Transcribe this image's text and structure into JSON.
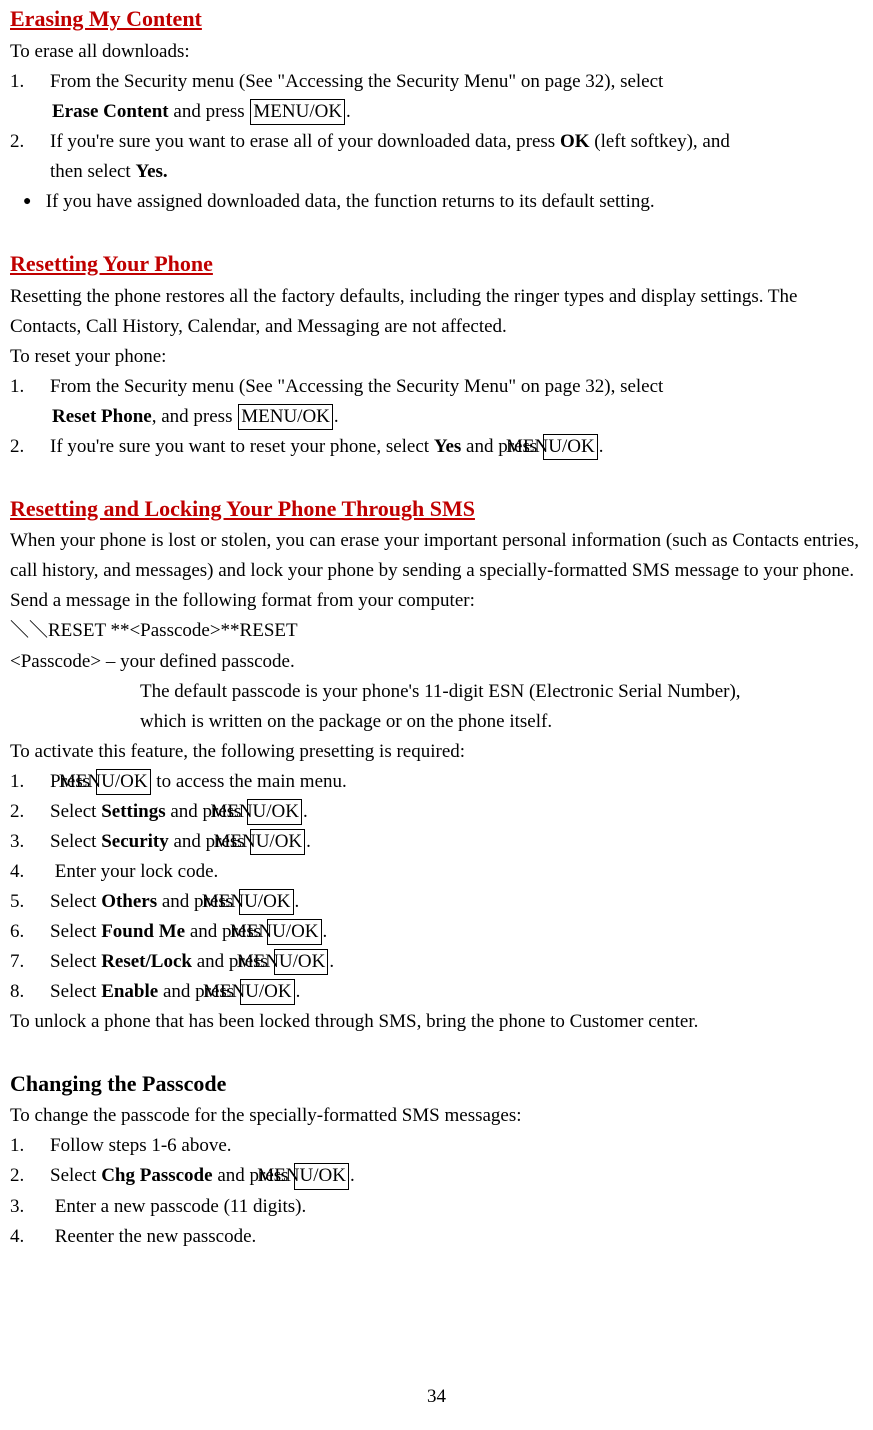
{
  "s1": {
    "heading": "Erasing My Content",
    "intro": "To erase all downloads:",
    "li1a": "From the Security menu (See \"Accessing the Security Menu\" on page 32), select",
    "li1b_bold": "Erase Content",
    "li1b_rest": " and press ",
    "li1b_box": "MENU/OK",
    "li1b_end": ".",
    "li2a": "If you're sure you want to erase all of your downloaded data, press ",
    "li2a_bold": "OK",
    "li2a_rest": " (left softkey), and",
    "li2b": "then select ",
    "li2b_bold": "Yes.",
    "bul": " If you have assigned downloaded data, the function returns to its default setting."
  },
  "s2": {
    "heading": "Resetting Your Phone",
    "p1": "Resetting the phone restores all the factory defaults, including the ringer types and display settings. The Contacts, Call History, Calendar, and Messaging are not affected.",
    "p2": "To reset your phone:",
    "li1a": "From the Security menu (See \"Accessing the Security Menu\" on page 32), select",
    "li1b_bold": "Reset Phone",
    "li1b_rest": ", and press ",
    "li1b_box": "MENU/OK",
    "li1b_end": ".",
    "li2a": "If you're sure you want to reset your phone, select ",
    "li2a_bold": "Yes",
    "li2a_rest": " and press ",
    "li2a_box": "MENU/OK",
    "li2a_end": "."
  },
  "s3": {
    "heading": "Resetting and Locking Your Phone Through SMS",
    "p1": "When your phone is lost or stolen, you can erase your important personal information (such as Contacts entries, call history, and messages) and lock your phone by sending a specially-formatted SMS message to your phone.",
    "p2": "Send a message in the following format from your computer:",
    "fmt": "＼＼RESET **<Passcode>**RESET",
    "pc1": "<Passcode> – your defined passcode.",
    "pc2": "The default passcode is your phone's 11-digit ESN (Electronic Serial Number),",
    "pc3": "which is written on the package or on the phone itself.",
    "p3": "To activate this feature, the following presetting is required:",
    "li1a": "Press ",
    "li1box": "MENU/OK",
    "li1b": " to access the main menu.",
    "li2a": "Select ",
    "li2bold": "Settings",
    "li2b": " and press ",
    "li2box": "MENU/OK",
    "li2c": ".",
    "li3a": "Select ",
    "li3bold": "Security",
    "li3b": " and press ",
    "li3box": "MENU/OK",
    "li3c": ".",
    "li4": " Enter your lock code.",
    "li5a": "Select ",
    "li5bold": "Others",
    "li5b": " and press ",
    "li5box": "MENU/OK",
    "li5c": ".",
    "li6a": "Select ",
    "li6bold": "Found Me",
    "li6b": " and press ",
    "li6box": "MENU/OK",
    "li6c": ".",
    "li7a": "Select ",
    "li7bold": "Reset/Lock",
    "li7b": " and press ",
    "li7box": "MENU/OK",
    "li7c": ".",
    "li8a": "Select ",
    "li8bold": "Enable",
    "li8b": " and press ",
    "li8box": "MENU/OK",
    "li8c": ".",
    "p4": "To unlock a phone that has been locked through SMS, bring the phone to Customer center."
  },
  "s4": {
    "heading": "Changing the Passcode",
    "p1": "To change the passcode for the specially-formatted SMS messages:",
    "li1": "Follow steps 1-6 above.",
    "li2a": "Select ",
    "li2bold": "Chg Passcode",
    "li2b": " and press ",
    "li2box": "MENU/OK",
    "li2c": ".",
    "li3": " Enter a new passcode (11 digits).",
    "li4": " Reenter the new passcode."
  },
  "pagenum": "34",
  "numbers": {
    "n1": "1.",
    "n2": "2.",
    "n3": "3.",
    "n4": "4.",
    "n5": "5.",
    "n6": "6.",
    "n7": "7.",
    "n8": "8."
  }
}
